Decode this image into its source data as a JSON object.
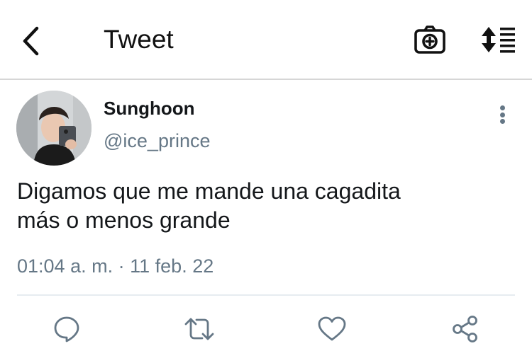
{
  "header": {
    "title": "Tweet",
    "icons": {
      "back": "chevron-left-icon",
      "camera": "camera-add-icon",
      "sort": "sort-list-icon"
    }
  },
  "tweet": {
    "author": {
      "name": "Sunghoon",
      "handle": "@ice_prince"
    },
    "text_lines": [
      "Digamos que me mande una cagadita",
      "más o menos grande"
    ],
    "time": "01:04 a. m.",
    "separator": "·",
    "date": "11 feb. 22"
  },
  "actions": [
    {
      "name": "reply",
      "icon": "comment-icon"
    },
    {
      "name": "retweet",
      "icon": "retweet-icon"
    },
    {
      "name": "like",
      "icon": "heart-icon"
    },
    {
      "name": "share",
      "icon": "share-icon"
    }
  ],
  "colors": {
    "text": "#14171a",
    "secondary": "#657786",
    "divider": "#e6ecf0",
    "header_divider": "#d6d6d6",
    "background": "#ffffff"
  }
}
